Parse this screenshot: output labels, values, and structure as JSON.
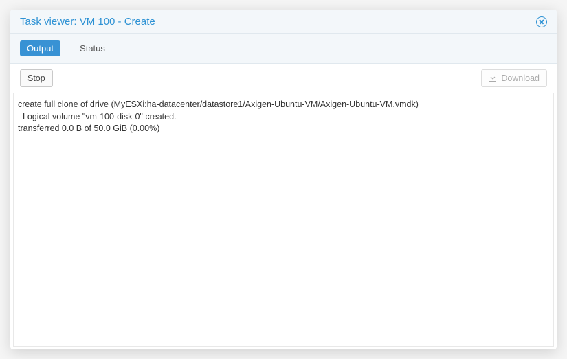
{
  "dialog": {
    "title": "Task viewer: VM 100 - Create"
  },
  "tabs": {
    "output": "Output",
    "status": "Status"
  },
  "toolbar": {
    "stop": "Stop",
    "download": "Download"
  },
  "output_lines": "create full clone of drive (MyESXi:ha-datacenter/datastore1/Axigen-Ubuntu-VM/Axigen-Ubuntu-VM.vmdk)\n  Logical volume \"vm-100-disk-0\" created.\ntransferred 0.0 B of 50.0 GiB (0.00%)"
}
